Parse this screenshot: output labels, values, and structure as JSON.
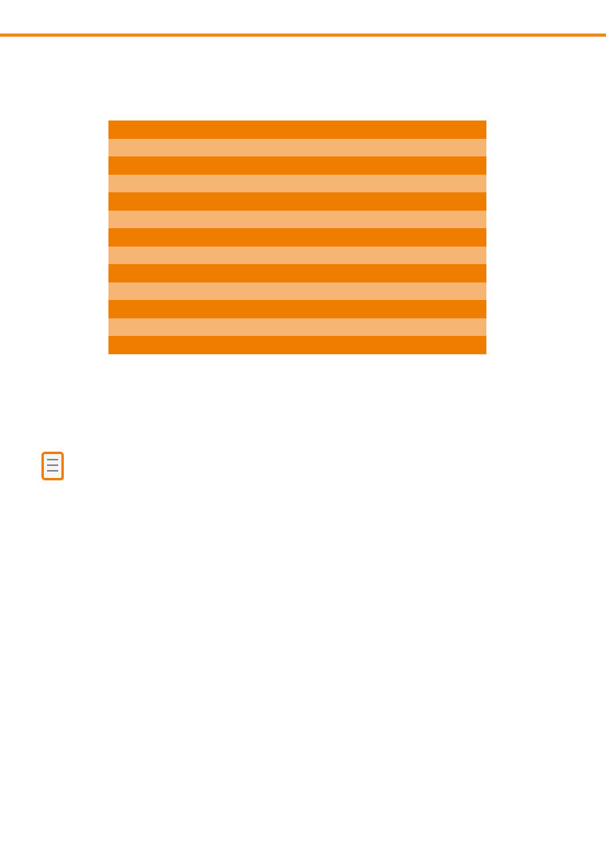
{
  "colors": {
    "accent": "#ef7d00",
    "accent_light": "#f7b574",
    "rule": "#ef8a1e",
    "icon_body": "#f6f6f6",
    "icon_lines": "#888888"
  },
  "table": {
    "rows": [
      {
        "style": "dark",
        "cells": [
          ""
        ]
      },
      {
        "style": "light",
        "cells": [
          ""
        ]
      },
      {
        "style": "dark",
        "cells": [
          ""
        ]
      },
      {
        "style": "light",
        "cells": [
          ""
        ]
      },
      {
        "style": "dark",
        "cells": [
          ""
        ]
      },
      {
        "style": "light",
        "cells": [
          ""
        ]
      },
      {
        "style": "dark",
        "cells": [
          ""
        ]
      },
      {
        "style": "light",
        "cells": [
          ""
        ]
      },
      {
        "style": "dark",
        "cells": [
          ""
        ]
      },
      {
        "style": "light",
        "cells": [
          ""
        ]
      },
      {
        "style": "dark",
        "cells": [
          ""
        ]
      },
      {
        "style": "light",
        "cells": [
          ""
        ]
      },
      {
        "style": "dark",
        "cells": [
          ""
        ]
      }
    ]
  },
  "note_icon": {
    "icon": "note-icon"
  }
}
